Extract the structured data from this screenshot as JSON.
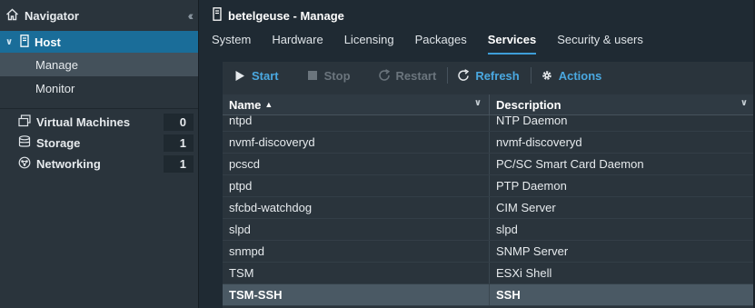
{
  "navigator": {
    "title": "Navigator",
    "host": {
      "label": "Host",
      "items": [
        "Manage",
        "Monitor"
      ],
      "active": "Manage"
    },
    "items": [
      {
        "label": "Virtual Machines",
        "count": "0",
        "icon": "virtual-machines-icon"
      },
      {
        "label": "Storage",
        "count": "1",
        "icon": "storage-icon"
      },
      {
        "label": "Networking",
        "count": "1",
        "icon": "networking-icon"
      }
    ]
  },
  "header": {
    "title": "betelgeuse - Manage"
  },
  "tabs": [
    "System",
    "Hardware",
    "Licensing",
    "Packages",
    "Services",
    "Security & users"
  ],
  "active_tab": "Services",
  "toolbar": {
    "start": "Start",
    "stop": "Stop",
    "restart": "Restart",
    "refresh": "Refresh",
    "actions": "Actions"
  },
  "table": {
    "columns": [
      "Name",
      "Description"
    ],
    "rows": [
      {
        "name": "ntpd",
        "description": "NTP Daemon"
      },
      {
        "name": "nvmf-discoveryd",
        "description": "nvmf-discoveryd"
      },
      {
        "name": "pcscd",
        "description": "PC/SC Smart Card Daemon"
      },
      {
        "name": "ptpd",
        "description": "PTP Daemon"
      },
      {
        "name": "sfcbd-watchdog",
        "description": "CIM Server"
      },
      {
        "name": "slpd",
        "description": "slpd"
      },
      {
        "name": "snmpd",
        "description": "SNMP Server"
      },
      {
        "name": "TSM",
        "description": "ESXi Shell"
      },
      {
        "name": "TSM-SSH",
        "description": "SSH"
      }
    ],
    "selected_row": "TSM-SSH"
  },
  "colors": {
    "accent": "#4aa8e0",
    "selection": "#1a6d99"
  }
}
